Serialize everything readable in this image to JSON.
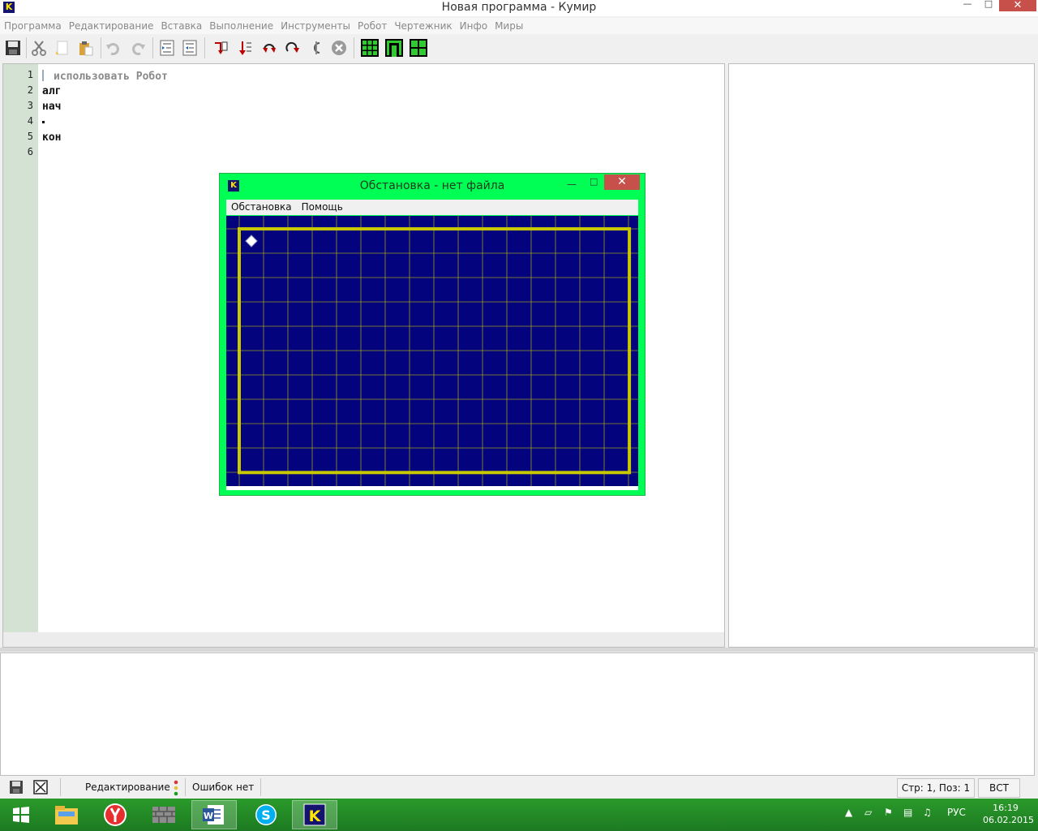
{
  "window": {
    "title": "Новая программа - Кумир",
    "app_icon_letter": "K"
  },
  "menu": [
    "Программа",
    "Редактирование",
    "Вставка",
    "Выполнение",
    "Инструменты",
    "Робот",
    "Чертежник",
    "Инфо",
    "Миры"
  ],
  "toolbar": {
    "icons": [
      "save-icon",
      "cut-icon",
      "copy-icon",
      "paste-icon",
      "undo-icon",
      "redo-icon",
      "indent-icon",
      "unindent-icon",
      "run-icon",
      "run-step-icon",
      "step-into-icon",
      "step-over-icon",
      "step-out-icon",
      "stop-icon",
      "robot-field-icon",
      "robot-window-icon",
      "draw-window-icon"
    ]
  },
  "editor": {
    "line_numbers": [
      "1",
      "2",
      "3",
      "4",
      "5",
      "6"
    ],
    "lines": [
      "использовать Робот",
      "алг",
      "нач",
      "",
      "кон",
      ""
    ]
  },
  "robot_window": {
    "title": "Обстановка - нет файла",
    "app_icon_letter": "K",
    "menu": [
      "Обстановка",
      "Помощь"
    ],
    "field": {
      "columns": 17,
      "rows": 11,
      "robot_column": 1,
      "robot_row": 1,
      "background_color": "#03037e",
      "grid_color": "#c8c800",
      "wall_color": "#c8c800",
      "robot_color": "#ffffff"
    }
  },
  "statusbar": {
    "mode": "Редактирование",
    "errors": "Ошибок нет",
    "position": "Стр: 1, Поз: 1",
    "insert_mode": "ВСТ"
  },
  "taskbar": {
    "apps": [
      "start-icon",
      "explorer-icon",
      "yandex-browser-icon",
      "firewall-icon",
      "word-icon",
      "skype-icon",
      "kumir-icon"
    ],
    "language": "РУС",
    "time": "16:19",
    "date": "06.02.2015"
  }
}
